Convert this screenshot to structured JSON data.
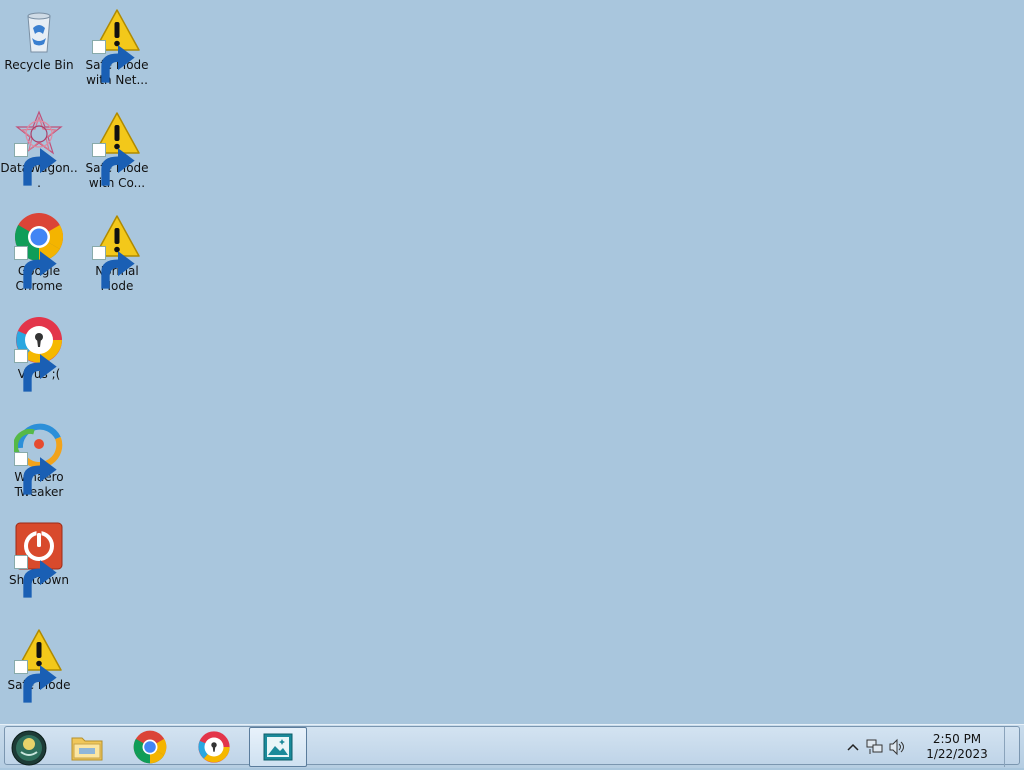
{
  "desktop": {
    "background_color": "#a9c6dd",
    "icons": [
      {
        "name": "recycle-bin",
        "label": "Recycle Bin",
        "icon": "recycle-bin-icon"
      },
      {
        "name": "safe-mode-networking",
        "label": "Safe Mode with Net...",
        "icon": "warning-icon"
      },
      {
        "name": "datawagon",
        "label": "DataWagon...",
        "icon": "datawagon-icon"
      },
      {
        "name": "safe-mode-command",
        "label": "Safe Mode with Co...",
        "icon": "warning-icon"
      },
      {
        "name": "google-chrome",
        "label": "Google Chrome",
        "icon": "chrome-icon"
      },
      {
        "name": "normal-mode",
        "label": "Normal Mode",
        "icon": "warning-icon"
      },
      {
        "name": "virus",
        "label": "Virus ;(",
        "icon": "secure-browser-icon"
      },
      {
        "name": "winaero-tweaker",
        "label": "Winaero Tweaker",
        "icon": "winaero-icon"
      },
      {
        "name": "shutdown",
        "label": "Shutdown",
        "icon": "power-icon"
      },
      {
        "name": "safe-mode",
        "label": "Safe Mode",
        "icon": "warning-icon"
      }
    ]
  },
  "taskbar": {
    "pinned": [
      "start-orb-icon",
      "file-explorer-icon",
      "chrome-icon",
      "secure-browser-icon",
      "photo-viewer-icon"
    ],
    "tray": {
      "icons": [
        "show-hidden-icons-chevron",
        "network-icon",
        "volume-icon"
      ],
      "time": "2:50 PM",
      "date": "1/22/2023"
    }
  }
}
